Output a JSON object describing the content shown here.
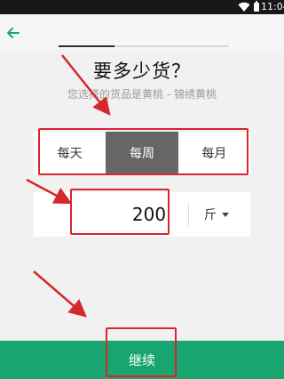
{
  "status_bar": {
    "time": "11:04",
    "wifi_icon": "wifi-icon",
    "battery_icon": "battery-icon"
  },
  "app_bar": {
    "back_icon": "arrow-left-icon",
    "step_progress": 0.33
  },
  "heading": {
    "title": "要多少货？",
    "subtitle": "您选择的货品是黄桃 - 锦绣黄桃"
  },
  "frequency": {
    "options": [
      "每天",
      "每周",
      "每月"
    ],
    "selected": "每周"
  },
  "quantity": {
    "value": "200",
    "unit": "斤",
    "unit_icon": "caret-down-icon"
  },
  "actions": {
    "continue_label": "继续"
  },
  "colors": {
    "accent": "#19a56f",
    "selected_segment": "#666666",
    "annotation": "#d6262e"
  }
}
